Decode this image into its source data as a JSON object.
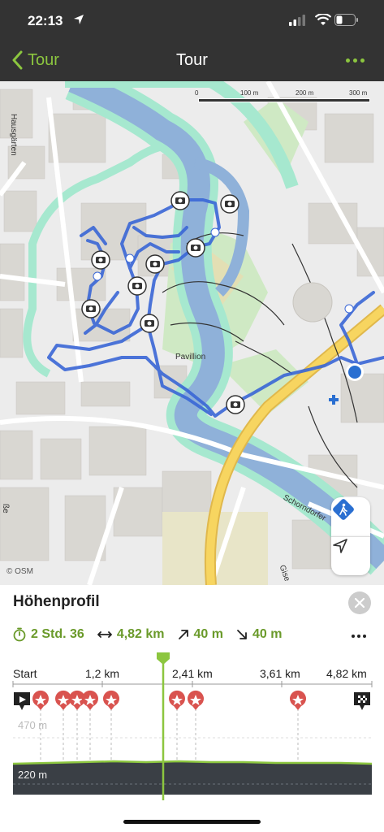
{
  "status_bar": {
    "time": "22:13"
  },
  "nav": {
    "back_label": "Tour",
    "title": "Tour"
  },
  "map": {
    "scale_labels": [
      "0",
      "100 m",
      "200 m",
      "300 m"
    ],
    "place_labels": {
      "hausgarten": "Hausgärten",
      "pavillion": "Pavillion",
      "schorndorfer": "Schorndorfer",
      "gise": "Gise",
      "sse": "ße"
    },
    "attribution": "© OSM",
    "colors": {
      "route": "#3a67d6",
      "river": "#8fb1d9",
      "park": "#a6e8cf",
      "road_major": "#f7d560"
    }
  },
  "profile": {
    "title": "Höhenprofil",
    "duration": "2 Std. 36",
    "distance": "4,82 km",
    "ascent": "40 m",
    "descent": "40 m",
    "distance_ticks": [
      "Start",
      "1,2 km",
      "2,41 km",
      "3,61 km",
      "4,82 km"
    ],
    "elevation_max": "470 m",
    "elevation_min": "220 m",
    "accent_color": "#8cc63f"
  }
}
